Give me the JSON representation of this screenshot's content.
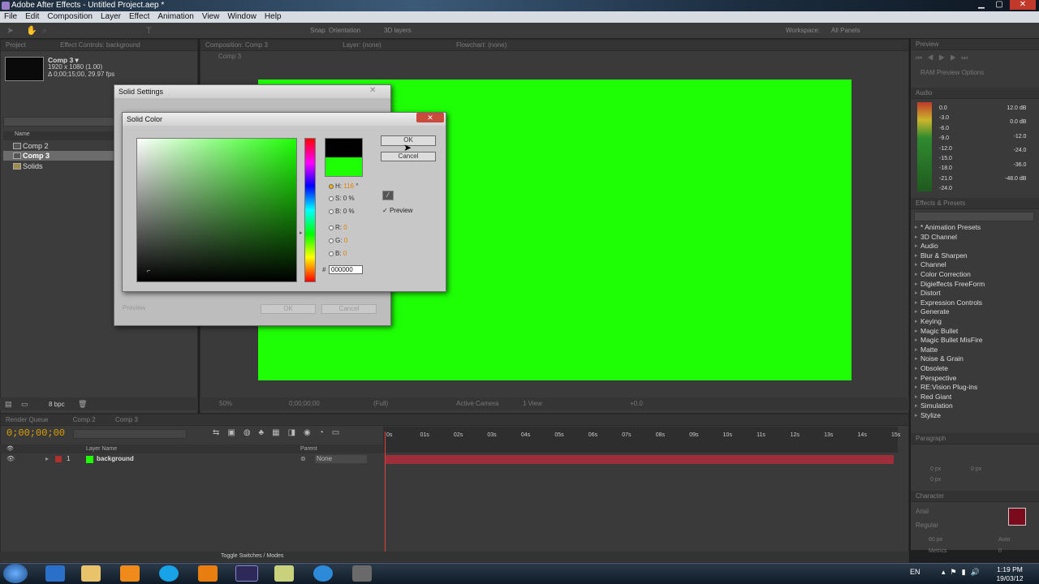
{
  "window": {
    "title": "Adobe After Effects - Untitled Project.aep *",
    "min": "▁",
    "max": "▢",
    "close": "✕"
  },
  "menu": [
    "File",
    "Edit",
    "Composition",
    "Layer",
    "Effect",
    "Animation",
    "View",
    "Window",
    "Help"
  ],
  "toolbar": {
    "snap": "Snap",
    "orientation": "Orientation",
    "layers3d": "3D layers",
    "workspace_label": "Workspace:",
    "workspace_value": "All Panels"
  },
  "project": {
    "tab_project": "Project",
    "tab_effect": "Effect Controls: background",
    "comp_name": "Comp 3 ▾",
    "comp_size": "1920 x 1080 (1.00)",
    "comp_duration": "Δ 0;00;15;00, 29.97 fps",
    "col_name": "Name",
    "items": [
      {
        "label": "Comp 2"
      },
      {
        "label": "Comp 3"
      },
      {
        "label": "Solids"
      }
    ],
    "bpc": "8 bpc"
  },
  "comp": {
    "tab": "Composition: Comp 3",
    "tab_flow": "Flowchart: (none)",
    "layer_tab": "Layer: (none)",
    "breadcrumb": "Comp 3",
    "zoom": "50%",
    "timecode": "0;00;00;00",
    "res": "(Full)",
    "camera": "Active Camera",
    "views": "1 View",
    "offset": "+0.0"
  },
  "solid_settings": {
    "title": "Solid Settings",
    "preview": "Preview",
    "ok": "OK",
    "cancel": "Cancel"
  },
  "solid_color": {
    "title": "Solid Color",
    "ok": "OK",
    "cancel": "Cancel",
    "h_label": "H:",
    "h_val": "116",
    "h_unit": "°",
    "s_label": "S:",
    "s_val": "0",
    "s_unit": "%",
    "b_label": "B:",
    "b_val": "0",
    "b_unit": "%",
    "r_label": "R:",
    "r_val": "0",
    "g_label": "G:",
    "g_val": "0",
    "bb_label": "B:",
    "bb_val": "0",
    "hash": "#",
    "hex": "000000",
    "preview": "Preview",
    "new_color": "#1eff06",
    "old_color": "#000000"
  },
  "preview_panel": {
    "tab": "Preview",
    "ram": "RAM Preview Options"
  },
  "audio": {
    "tab": "Audio",
    "left": [
      "0.0",
      "-3.0",
      "-6.0",
      "-9.0",
      "-12.0",
      "-15.0",
      "-18.0",
      "-21.0",
      "-24.0"
    ],
    "right": [
      "12.0 dB",
      "0.0 dB",
      "-12.0",
      "-24.0",
      "-36.0",
      "-48.0 dB"
    ]
  },
  "effects": {
    "tab": "Effects & Presets",
    "items": [
      "* Animation Presets",
      "3D Channel",
      "Audio",
      "Blur & Sharpen",
      "Channel",
      "Color Correction",
      "Digieffects FreeForm",
      "Distort",
      "Expression Controls",
      "Generate",
      "Keying",
      "Magic Bullet",
      "Magic Bullet MisFire",
      "Matte",
      "Noise & Grain",
      "Obsolete",
      "Perspective",
      "RE:Vision Plug-ins",
      "Red Giant",
      "Simulation",
      "Stylize"
    ]
  },
  "paragraph": {
    "tab": "Paragraph",
    "px": [
      "0 px",
      "0 px",
      "0 px"
    ]
  },
  "character": {
    "tab": "Character",
    "font": "Arial",
    "style": "Regular",
    "size": "60 px",
    "auto": "Auto",
    "metrics": "Metrics",
    "zero": "0",
    "swatch": "#7a0a1c"
  },
  "timeline": {
    "tab_render": "Render Queue",
    "tab_comp2": "Comp 2",
    "tab_comp3": "Comp 3",
    "timecode": "0;00;00;00",
    "col_layer": "Layer Name",
    "col_parent": "Parent",
    "layer_num": "1",
    "layer_name": "background",
    "parent_val": "None",
    "ruler": [
      "0s",
      "01s",
      "02s",
      "03s",
      "04s",
      "05s",
      "06s",
      "07s",
      "08s",
      "09s",
      "10s",
      "11s",
      "12s",
      "13s",
      "14s",
      "15s"
    ],
    "toggle": "Toggle Switches / Modes"
  },
  "taskbar": {
    "lang": "EN",
    "time": "1:19 PM",
    "date": "19/03/12",
    "apps": [
      "start",
      "ie",
      "explorer",
      "media",
      "skype",
      "outlook",
      "ae",
      "notepad",
      "app",
      "tool"
    ]
  }
}
